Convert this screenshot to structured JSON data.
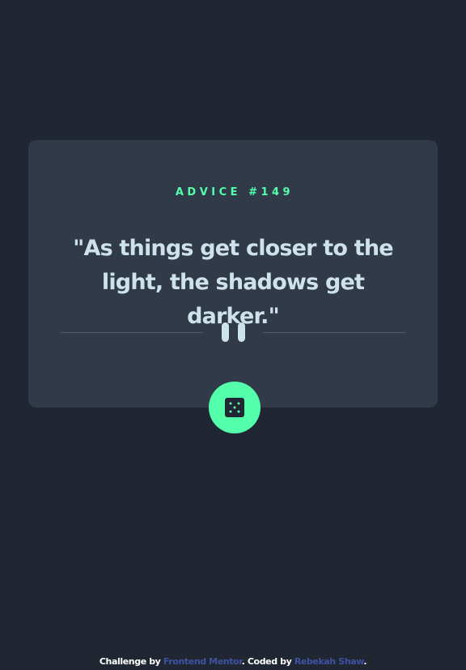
{
  "advice": {
    "label": "ADVICE #149",
    "quote": "\"As things get closer to the light, the shadows get darker.\""
  },
  "divider": {
    "icon": "pause-icon"
  },
  "dice_button": {
    "icon": "dice-icon"
  },
  "footer": {
    "prefix": "Challenge by ",
    "challenge_link": "Frontend Mentor",
    "middle": ". Coded by ",
    "author_link": "Rebekah Shaw",
    "suffix": "."
  },
  "colors": {
    "background": "#202733",
    "card": "#313a48",
    "accent": "#53ffaa",
    "text": "#cee3e9",
    "divider": "#4f5d74",
    "link": "#3e52a3"
  }
}
